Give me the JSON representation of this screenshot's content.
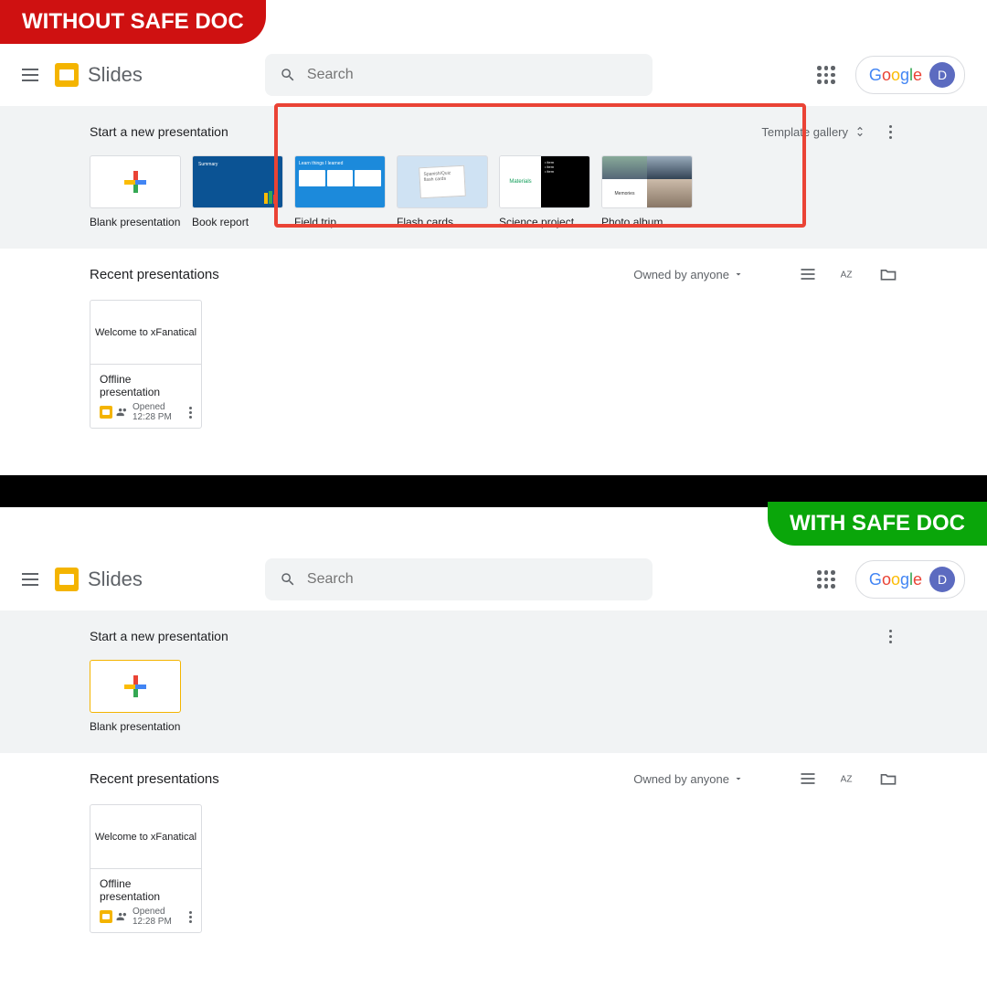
{
  "tags": {
    "without": "WITHOUT SAFE DOC",
    "with": "WITH SAFE DOC"
  },
  "header": {
    "app_name": "Slides",
    "search_placeholder": "Search",
    "avatar_letter": "D",
    "google_text": "Google"
  },
  "start": {
    "title": "Start a new presentation",
    "gallery_label": "Template gallery"
  },
  "templates": {
    "blank": "Blank presentation",
    "book": "Book report",
    "book_summary": "Summary",
    "field": "Field trip",
    "field_hdr": "Learn things I learned",
    "flash": "Flash cards",
    "flash_text": "Spanish/Quiz\nflash cards",
    "science": "Science project",
    "science_mat": "Materials",
    "photo": "Photo album",
    "photo_text": "Memories"
  },
  "recent": {
    "title": "Recent presentations",
    "filter": "Owned by anyone",
    "item_title": "Welcome to xFanatical",
    "item_name": "Offline presentation",
    "item_opened": "Opened 12:28 PM"
  }
}
